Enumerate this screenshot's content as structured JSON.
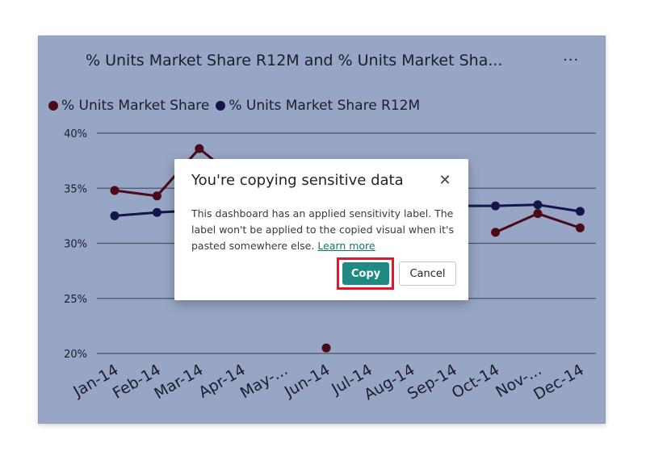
{
  "visual": {
    "title": "% Units Market Share R12M and % Units Market Sha...",
    "more_options": "···"
  },
  "legend": [
    {
      "label": "% Units Market Share",
      "color": "#4a0a1a"
    },
    {
      "label": "% Units Market Share R12M",
      "color": "#15154a"
    }
  ],
  "chart_data": {
    "type": "line",
    "categories": [
      "Jan-14",
      "Feb-14",
      "Mar-14",
      "Apr-14",
      "May-...",
      "Jun-14",
      "Jul-14",
      "Aug-14",
      "Sep-14",
      "Oct-14",
      "Nov-...",
      "Dec-14"
    ],
    "series": [
      {
        "name": "% Units Market Share",
        "color": "#4a0a1a",
        "values": [
          34.8,
          34.3,
          38.6,
          35.5,
          null,
          20.5,
          null,
          null,
          null,
          31.0,
          32.7,
          31.4
        ]
      },
      {
        "name": "% Units Market Share R12M",
        "color": "#15154a",
        "values": [
          32.5,
          32.8,
          33.0,
          null,
          null,
          null,
          null,
          null,
          33.4,
          33.4,
          33.5,
          32.9
        ]
      }
    ],
    "yticks": [
      "40%",
      "35%",
      "30%",
      "25%",
      "20%"
    ],
    "ylim": [
      20,
      40
    ],
    "grid": true,
    "legend_position": "top-left"
  },
  "dialog": {
    "title": "You're copying sensitive data",
    "close_icon": "close-icon",
    "body": "This dashboard has an applied sensitivity label. The label won't be applied to the copied visual when it's pasted somewhere else.",
    "link": "Learn more",
    "copy_label": "Copy",
    "cancel_label": "Cancel",
    "highlight_color": "#e0182d"
  }
}
